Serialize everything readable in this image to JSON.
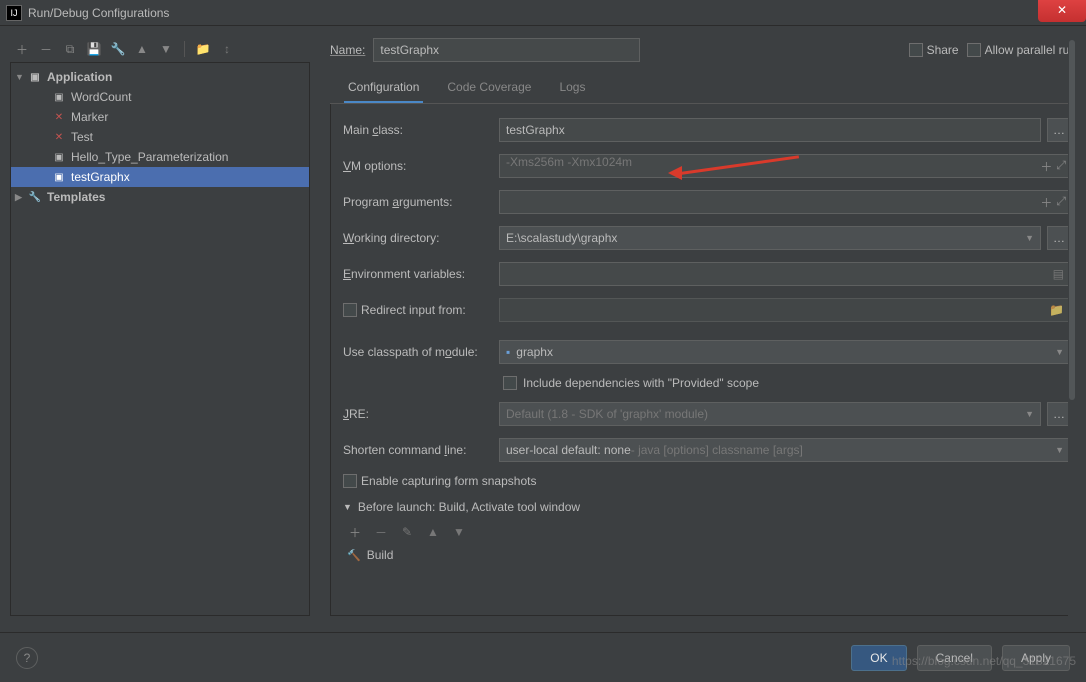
{
  "window": {
    "title": "Run/Debug Configurations"
  },
  "toolbar_icons": [
    "add",
    "remove",
    "copy",
    "save",
    "wrench",
    "up",
    "down",
    "folder",
    "sort"
  ],
  "tree": {
    "application": {
      "label": "Application"
    },
    "items": [
      {
        "label": "WordCount"
      },
      {
        "label": "Marker"
      },
      {
        "label": "Test"
      },
      {
        "label": "Hello_Type_Parameterization"
      },
      {
        "label": "testGraphx",
        "selected": true
      }
    ],
    "templates": {
      "label": "Templates"
    }
  },
  "header": {
    "name_label": "Name:",
    "name_value": "testGraphx",
    "share_label": "Share",
    "parallel_label": "Allow parallel run"
  },
  "tabs": {
    "config": "Configuration",
    "coverage": "Code Coverage",
    "logs": "Logs"
  },
  "form": {
    "main_class_label": "Main class:",
    "main_class_value": "testGraphx",
    "vm_options_label": "VM options:",
    "vm_options_value": "-Xms256m -Xmx1024m",
    "program_args_label": "Program arguments:",
    "working_dir_label": "Working directory:",
    "working_dir_value": "E:\\scalastudy\\graphx",
    "env_vars_label": "Environment variables:",
    "redirect_label": "Redirect input from:",
    "classpath_label": "Use classpath of module:",
    "classpath_value": "graphx",
    "include_deps_label": "Include dependencies with \"Provided\" scope",
    "jre_label": "JRE:",
    "jre_value": "Default (1.8 - SDK of 'graphx' module)",
    "shorten_label": "Shorten command line:",
    "shorten_value": "user-local default: none",
    "shorten_hint": " - java [options] classname [args]",
    "enable_capture_label": "Enable capturing form snapshots",
    "before_launch_label": "Before launch: Build, Activate tool window",
    "build_label": "Build"
  },
  "buttons": {
    "ok": "OK",
    "cancel": "Cancel",
    "apply": "Apply"
  },
  "watermark": "https://blog.csdn.net/qq_31821675"
}
